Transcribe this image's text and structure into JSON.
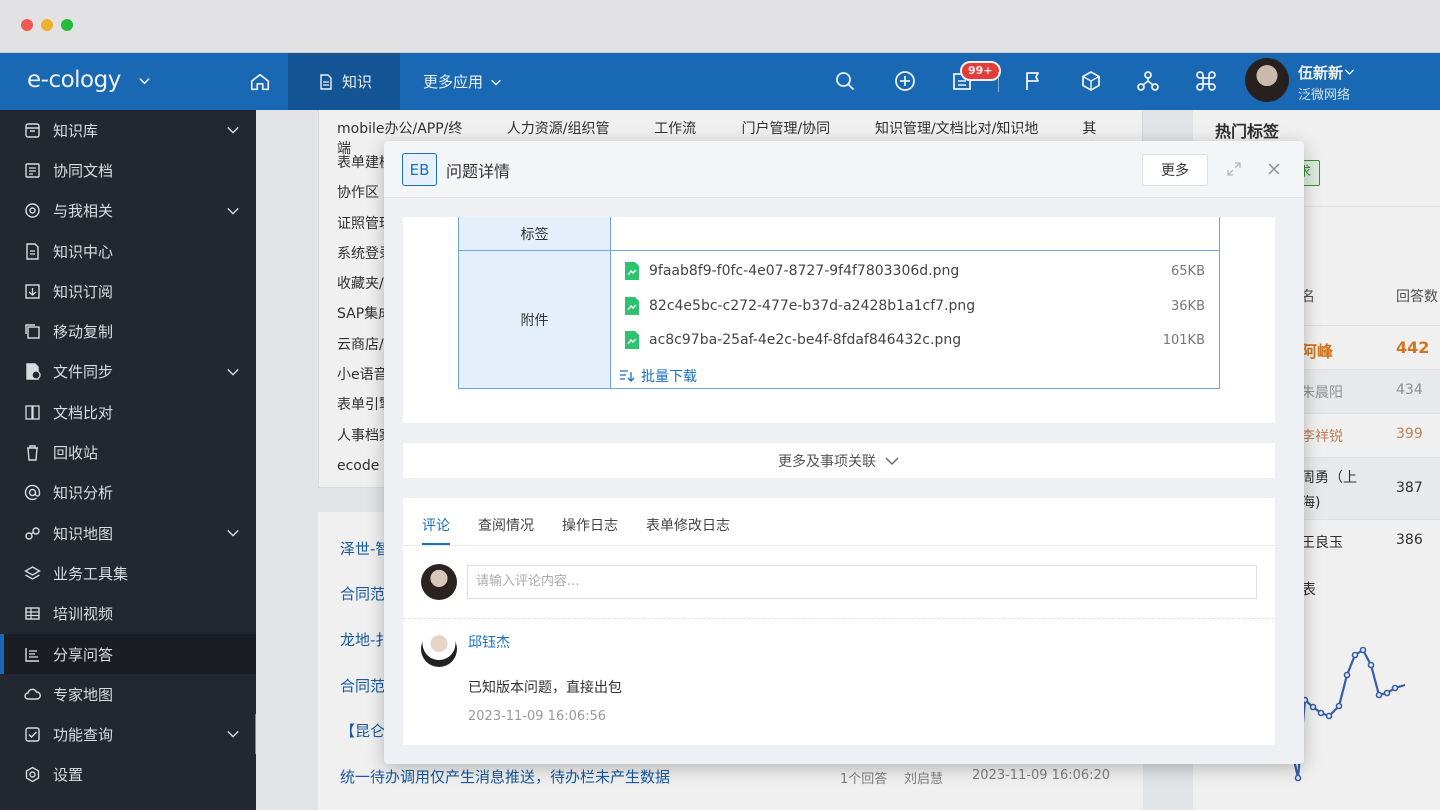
{
  "topnav": {
    "logo": "e-cology",
    "knowledge_tab": "知识",
    "more_apps": "更多应用",
    "badge": "99+",
    "user_name": "伍新新",
    "company": "泛微网络"
  },
  "sidebar": {
    "items": [
      {
        "label": "知识库",
        "icon": "archive-icon",
        "expand": true
      },
      {
        "label": "协同文档",
        "icon": "document-icon",
        "expand": false
      },
      {
        "label": "与我相关",
        "icon": "target-icon",
        "expand": true
      },
      {
        "label": "知识中心",
        "icon": "file-icon",
        "expand": false
      },
      {
        "label": "知识订阅",
        "icon": "subscribe-icon",
        "expand": false
      },
      {
        "label": "移动复制",
        "icon": "copy-icon",
        "expand": false
      },
      {
        "label": "文件同步",
        "icon": "sync-icon",
        "expand": true
      },
      {
        "label": "文档比对",
        "icon": "compare-icon",
        "expand": false
      },
      {
        "label": "回收站",
        "icon": "trash-icon",
        "expand": false
      },
      {
        "label": "知识分析",
        "icon": "at-icon",
        "expand": false
      },
      {
        "label": "知识地图",
        "icon": "map-icon",
        "expand": true
      },
      {
        "label": "业务工具集",
        "icon": "layers-icon",
        "expand": false
      },
      {
        "label": "培训视频",
        "icon": "grid-icon",
        "expand": false
      },
      {
        "label": "分享问答",
        "icon": "chart-icon",
        "expand": false,
        "active": true
      },
      {
        "label": "专家地图",
        "icon": "cloud-icon",
        "expand": false
      },
      {
        "label": "功能查询",
        "icon": "checkbox-icon",
        "expand": true
      },
      {
        "label": "设置",
        "icon": "settings-icon",
        "expand": false
      }
    ]
  },
  "background": {
    "categories": [
      "mobile办公/APP/终端",
      "人力资源/组织管理",
      "工作流程",
      "门户管理/协同区",
      "知识管理/文档比对/知识地图",
      "其他"
    ],
    "cat_column": [
      "表单建模",
      "协作区",
      "证照管理",
      "系统登录",
      "收藏夹/",
      "SAP集成",
      "云商店/",
      "小e语音",
      "表单引擎",
      "人事档案",
      "ecode"
    ],
    "questions": [
      "泽世-智",
      "合同范",
      "龙地-扌",
      "合同范",
      "【昆仑"
    ],
    "last_question": "统一待办调用仅产生消息推送，待办栏未产生数据",
    "last_answers": "1个回答",
    "last_author": "刘启慧",
    "last_time": "2023-11-09 16:06:20",
    "right_title": "热门标签",
    "right_tag": "求",
    "right_head_name": "名",
    "right_head_count": "回答数",
    "ranking": [
      {
        "name": "阿峰",
        "count": "442"
      },
      {
        "name": "朱晨阳",
        "count": "434"
      },
      {
        "name": "李祥锐",
        "count": "399"
      },
      {
        "name": "周勇（上",
        "count": "387"
      },
      {
        "name": "海)",
        "count": ""
      },
      {
        "name": "王良玉",
        "count": "386"
      }
    ],
    "chart_title": "表"
  },
  "modal": {
    "eb": "EB",
    "title": "问题详情",
    "more_button": "更多",
    "tag_label": "标签",
    "attach_label": "附件",
    "attachments": [
      {
        "name": "9faab8f9-f0fc-4e07-8727-9f4f7803306d.png",
        "size": "65KB"
      },
      {
        "name": "82c4e5bc-c272-477e-b37d-a2428b1a1cf7.png",
        "size": "36KB"
      },
      {
        "name": "ac8c97ba-25af-4e2c-be4f-8fdaf846432c.png",
        "size": "101KB"
      }
    ],
    "batch_download": "批量下载",
    "more_relations": "更多及事项关联",
    "tabs": [
      "评论",
      "查阅情况",
      "操作日志",
      "表单修改日志"
    ],
    "comment_placeholder": "请输入评论内容...",
    "comment": {
      "author": "邱钰杰",
      "text": "已知版本问题，直接出包",
      "time": "2023-11-09 16:06:56"
    }
  }
}
